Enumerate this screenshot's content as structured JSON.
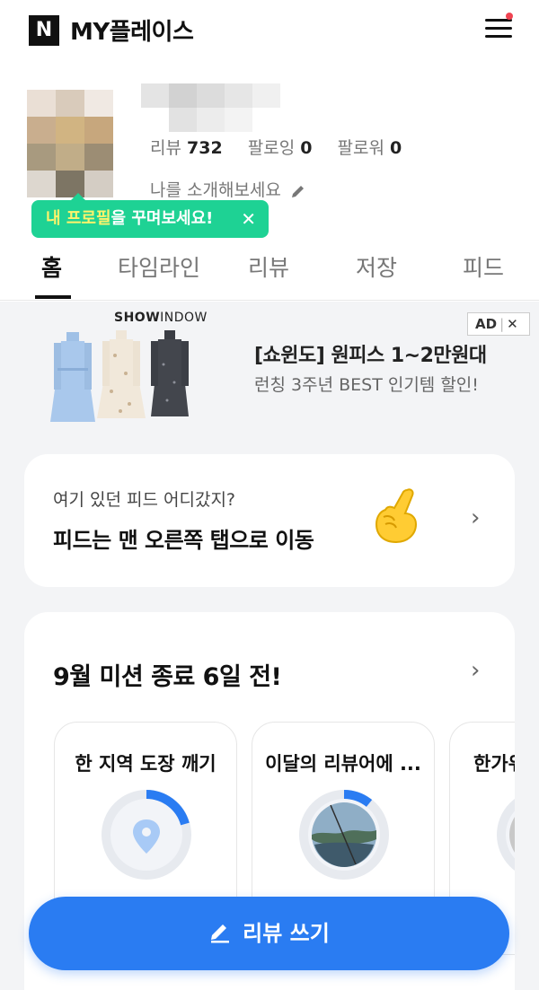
{
  "header": {
    "logo_letter": "N",
    "title": "MY플레이스"
  },
  "profile": {
    "stats": [
      {
        "label": "리뷰",
        "value": "732"
      },
      {
        "label": "팔로잉",
        "value": "0"
      },
      {
        "label": "팔로워",
        "value": "0"
      }
    ],
    "intro_placeholder": "나를 소개해보세요",
    "promo": {
      "highlight": "내 프로필",
      "rest": "을 꾸며보세요!",
      "close": "✕"
    }
  },
  "tabs": [
    {
      "label": "홈",
      "active": true
    },
    {
      "label": "타임라인",
      "active": false
    },
    {
      "label": "리뷰",
      "active": false
    },
    {
      "label": "저장",
      "active": false
    },
    {
      "label": "피드",
      "active": false
    }
  ],
  "ad": {
    "brand_bold": "SHOW",
    "brand_light": "INDOW",
    "badge": "AD",
    "badge_close": "✕",
    "title": "[쇼윈도] 원피스 1~2만원대",
    "subtitle": "런칭 3주년 BEST 인기템 할인!"
  },
  "feed_notice": {
    "question": "여기 있던 피드 어디갔지?",
    "title": "피드는 맨 오른쪽 탭으로 이동",
    "emoji": "☝"
  },
  "missions": {
    "title": "9월 미션 종료 6일 전!",
    "items": [
      {
        "title": "한 지역 도장 깨기",
        "icon": "location-pin-icon",
        "progress": 0.3
      },
      {
        "title": "이달의 리뷰어에 ...",
        "icon": "photo-thumbnail",
        "progress": 0.13
      },
      {
        "title": "한가위",
        "icon": "photo-thumbnail",
        "progress": 0
      }
    ]
  },
  "write_button": {
    "label": "리뷰 쓰기",
    "icon": "pencil-icon"
  },
  "colors": {
    "primary": "#2a7cf2",
    "promo_green": "#1ed294",
    "promo_highlight": "#fff36b",
    "notification_dot": "#f04452",
    "section_bg": "#f3f4f6"
  }
}
